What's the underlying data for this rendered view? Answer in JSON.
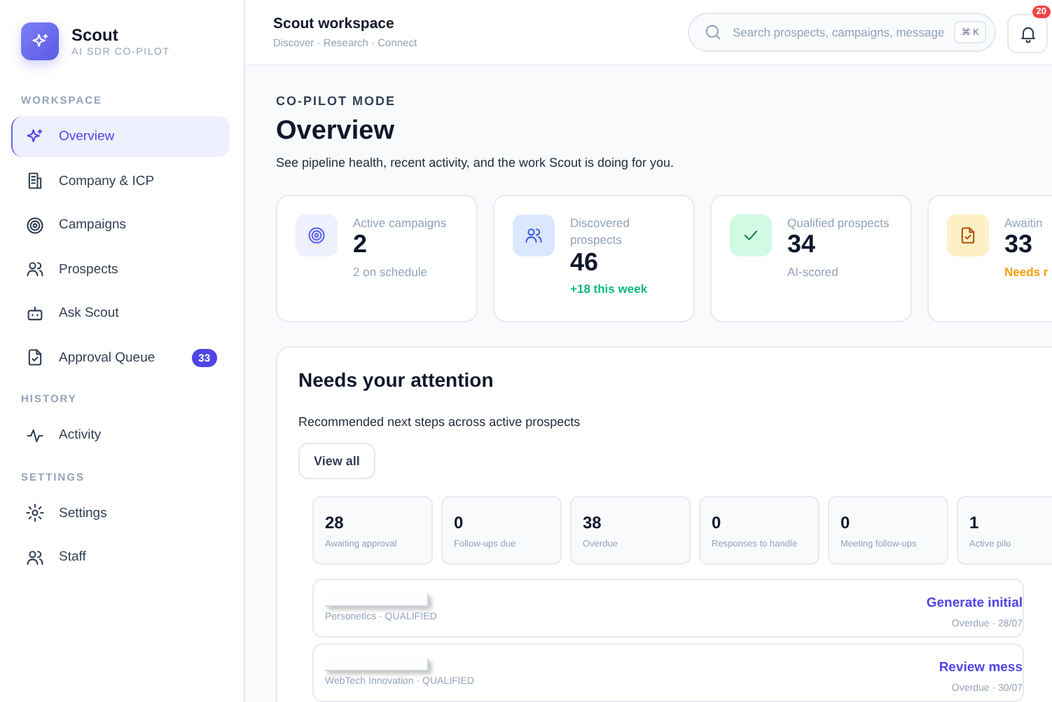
{
  "brand": {
    "name": "Scout",
    "tagline": "AI SDR CO-PILOT"
  },
  "sidebar": {
    "sections": [
      {
        "title": "WORKSPACE",
        "items": [
          {
            "label": "Overview",
            "selected": true
          },
          {
            "label": "Company & ICP",
            "selected": false
          },
          {
            "label": "Campaigns",
            "selected": false
          },
          {
            "label": "Prospects",
            "selected": false
          },
          {
            "label": "Ask Scout",
            "selected": false
          },
          {
            "label": "Approval Queue",
            "selected": false,
            "badge": "33"
          }
        ]
      },
      {
        "title": "HISTORY",
        "items": [
          {
            "label": "Activity",
            "selected": false
          }
        ]
      },
      {
        "title": "SETTINGS",
        "items": [
          {
            "label": "Settings",
            "selected": false
          },
          {
            "label": "Staff",
            "selected": false
          }
        ]
      }
    ]
  },
  "header": {
    "title": "Scout workspace",
    "subtitle": "Discover · Research · Connect",
    "search": {
      "placeholder": "Search prospects, campaigns, message",
      "shortcut": "⌘ K"
    },
    "notifications": "20"
  },
  "page": {
    "eyebrow": "CO-PILOT MODE",
    "title": "Overview",
    "description": "See pipeline health, recent activity, and the work Scout is doing for you."
  },
  "stats": [
    {
      "label": "Active campaigns",
      "value": "2",
      "note": "2 on schedule",
      "kind": "muted"
    },
    {
      "label": "Discovered prospects",
      "value": "46",
      "note": "+18 this week",
      "kind": "positive"
    },
    {
      "label": "Qualified prospects",
      "value": "34",
      "note": "AI-scored",
      "kind": "muted"
    },
    {
      "label": "Awaitin",
      "value": "33",
      "note": "Needs r",
      "kind": "warning"
    }
  ],
  "attention": {
    "title": "Needs your attention",
    "description": "Recommended next steps across active prospects",
    "button": "View all",
    "metrics": [
      {
        "value": "28",
        "label": "Awaiting approval"
      },
      {
        "value": "0",
        "label": "Follow-ups due"
      },
      {
        "value": "38",
        "label": "Overdue"
      },
      {
        "value": "0",
        "label": "Responses to handle"
      },
      {
        "value": "0",
        "label": "Meeting follow-ups"
      },
      {
        "value": "1",
        "label": "Active pilo"
      }
    ],
    "tasks": [
      {
        "company": "Personetics · QUALIFIED",
        "action": "Generate initial",
        "due": "Overdue · 28/07"
      },
      {
        "company": "WebTech Innovation · QUALIFIED",
        "action": "Review mess",
        "due": "Overdue · 30/07"
      }
    ]
  }
}
